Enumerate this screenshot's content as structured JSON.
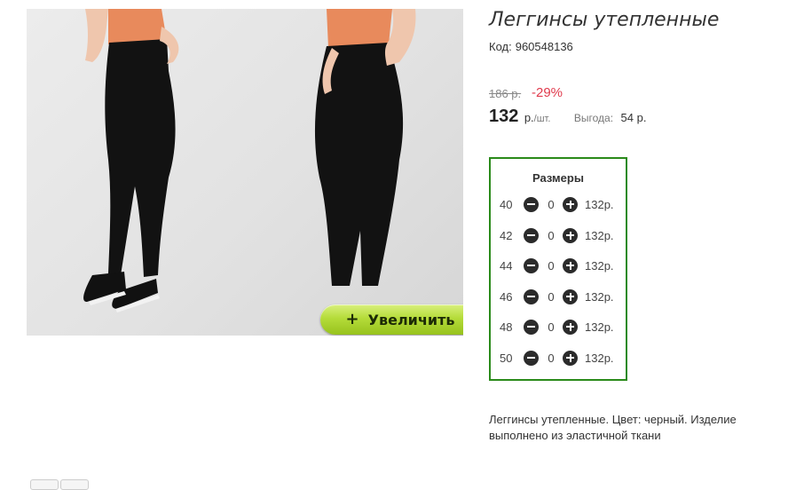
{
  "product": {
    "title": "Леггинсы утепленные",
    "code_label": "Код:",
    "code": "960548136",
    "old_price": "186 р.",
    "discount": "-29%",
    "price": "132",
    "unit": "р.",
    "unit_suffix": "/шт.",
    "benefit_label": "Выгода:",
    "benefit": "54 р.",
    "description": "Леггинсы утепленные. Цвет: черный. Изделие выполнено из эластичной ткани"
  },
  "zoom_button": {
    "label": "Увеличить",
    "icon": "plus-icon"
  },
  "sizes": {
    "title": "Размеры",
    "rows": [
      {
        "size": "40",
        "qty": "0",
        "price": "132р."
      },
      {
        "size": "42",
        "qty": "0",
        "price": "132р."
      },
      {
        "size": "44",
        "qty": "0",
        "price": "132р."
      },
      {
        "size": "46",
        "qty": "0",
        "price": "132р."
      },
      {
        "size": "48",
        "qty": "0",
        "price": "132р."
      },
      {
        "size": "50",
        "qty": "0",
        "price": "132р."
      }
    ]
  },
  "colors": {
    "discount": "#e03a4c",
    "sizes_border": "#2a8a1a",
    "zoom_button": "#b5dc3a"
  }
}
